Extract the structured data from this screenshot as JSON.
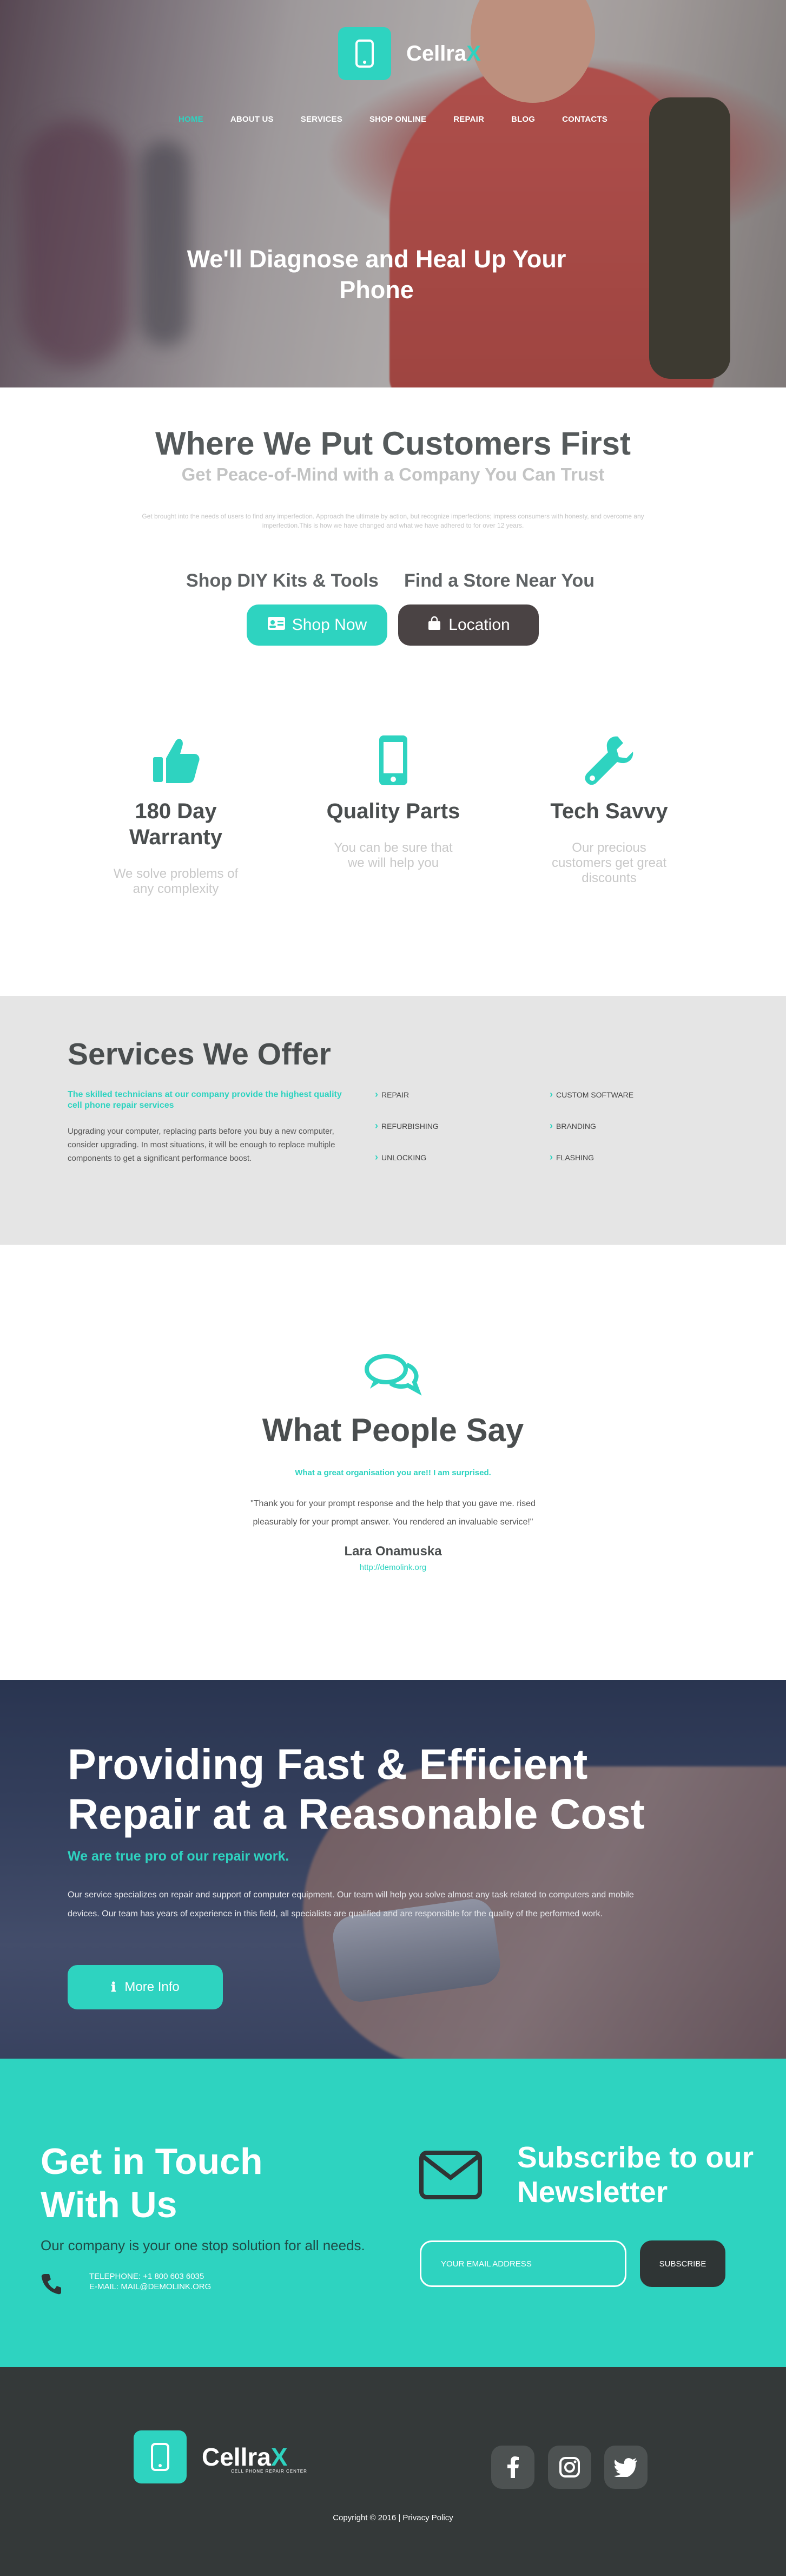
{
  "brand": {
    "name_main": "Cellra",
    "name_accent": "X",
    "tagline": "Cell phone repair center"
  },
  "nav": {
    "items": [
      {
        "label": "HOME"
      },
      {
        "label": "ABOUT US"
      },
      {
        "label": "SERVICES"
      },
      {
        "label": "SHOP ONLINE"
      },
      {
        "label": "REPAIR"
      },
      {
        "label": "BLOG"
      },
      {
        "label": "CONTACTS"
      }
    ]
  },
  "hero": {
    "title": "We'll Diagnose and Heal Up Your Phone"
  },
  "intro": {
    "title": "Where We Put Customers First",
    "subtitle": "Get Peace-of-Mind with a Company You Can Trust",
    "text": "Get brought into the needs of users to find any imperfection. Approach the ultimate by action, but recognize imperfections; impress consumers with honesty, and overcome any imperfection.This is how we have changed and what we have adhered to for over 12 years.",
    "cta_shop_label": "Shop DIY Kits & Tools",
    "cta_store_label": "Find a Store Near You",
    "shop_button": "Shop Now",
    "location_button": "Location"
  },
  "features": [
    {
      "icon": "thumbs-up-icon",
      "title": "180 Day Warranty",
      "text": "We solve problems of any complexity"
    },
    {
      "icon": "smartphone-icon",
      "title": "Quality Parts",
      "text": "You can be sure that we will help you"
    },
    {
      "icon": "wrench-icon",
      "title": "Tech Savvy",
      "text": "Our precious customers get great discounts"
    }
  ],
  "services": {
    "title": "Services We Offer",
    "lead": "The skilled technicians at our company provide the highest quality cell phone repair services",
    "text": "Upgrading your computer, replacing parts before you buy a new computer, consider upgrading. In most situations, it will be enough to replace multiple components to get a significant performance boost.",
    "col1": [
      "REPAIR",
      "REFURBISHING",
      "UNLOCKING"
    ],
    "col2": [
      "CUSTOM SOFTWARE",
      "BRANDING",
      "FLASHING"
    ]
  },
  "testimonial": {
    "title": "What People Say",
    "lead": "What a great organisation you are!! I am surprised.",
    "quote": "\"Thank you for your prompt response and the help that you gave me. rised pleasurably for your prompt answer. You rendered an invaluable service!\"",
    "name": "Lara Onamuska",
    "link": "http://demolink.org"
  },
  "repair": {
    "title": "Providing Fast & Efficient Repair at a Reasonable Cost",
    "lead": "We are true pro of our repair work.",
    "text": "Our service specializes on repair and support of computer equipment. Our team will help you solve almost any task related to computers and mobile devices. Our team has years of experience in this field, all specialists are qualified and are responsible for the quality of the performed work.",
    "button": "More Info"
  },
  "contact": {
    "title": "Get in Touch With Us",
    "lead": "Our company is your one stop solution for all needs.",
    "phone": "TELEPHONE: +1 800 603 6035",
    "email": "E-MAIL: MAIL@DEMOLINK.ORG",
    "newsletter_title": "Subscribe to our Newsletter",
    "email_placeholder": "YOUR EMAIL ADDRESS",
    "subscribe_button": "SUBSCRIBE"
  },
  "footer": {
    "copyright": "Copyright © 2016 | Privacy Policy",
    "social": [
      "facebook-icon",
      "instagram-icon",
      "twitter-icon"
    ]
  },
  "colors": {
    "accent": "#2ed3c0",
    "dark": "#343939",
    "text": "#4a4e4f",
    "light_gray": "#e5e5e5"
  }
}
